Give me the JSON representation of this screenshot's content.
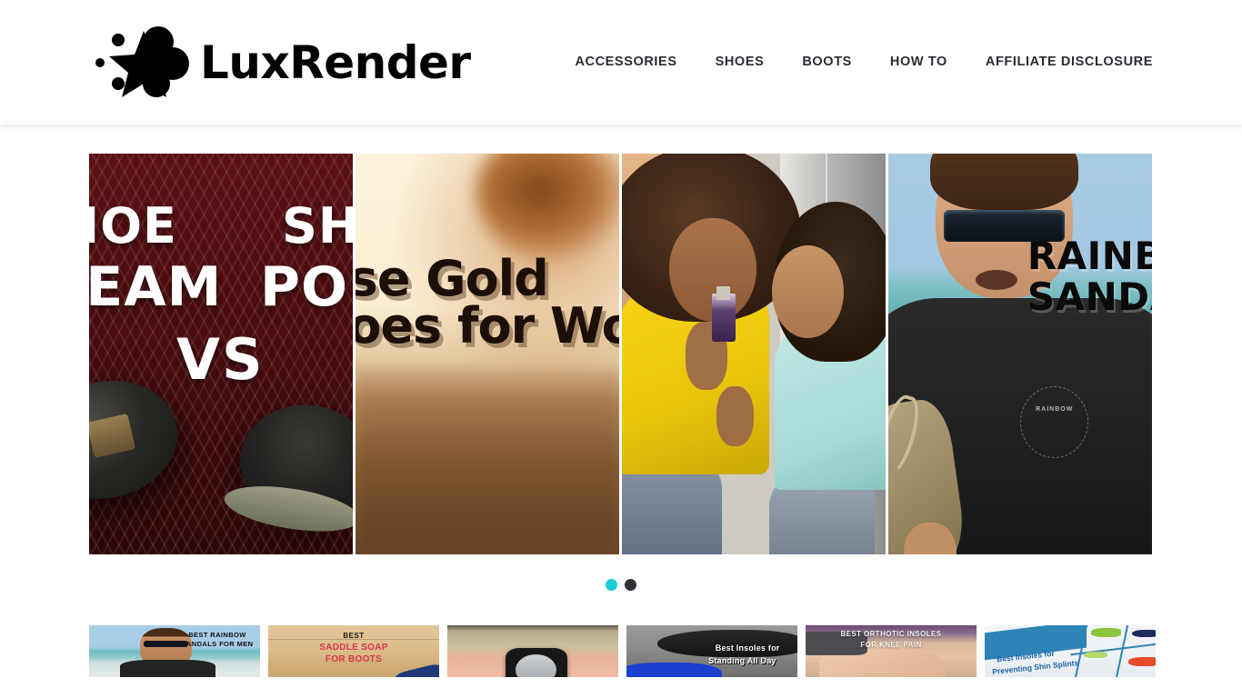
{
  "site": {
    "brand_name": "LuxRender",
    "logo_icon": "star-splat-icon"
  },
  "nav": {
    "items": [
      {
        "label": "ACCESSORIES"
      },
      {
        "label": "SHOES"
      },
      {
        "label": "BOOTS"
      },
      {
        "label": "HOW TO"
      },
      {
        "label": "AFFILIATE DISCLOSURE"
      }
    ]
  },
  "carousel": {
    "slides": [
      {
        "name": "shoe-cream-vs-shoe-polish",
        "line_left_1": "SHOE",
        "line_left_2": "CREAM",
        "line_right_1": "SHOE",
        "line_right_2": "POLISH",
        "vs": "VS"
      },
      {
        "name": "rose-gold-shoes-for-women",
        "title": "Rose Gold\nShoes for Women"
      },
      {
        "name": "essential-oils-mother-and-child",
        "title": ""
      },
      {
        "name": "rainbow-sandals",
        "title": "RAINBOW\nSANDALS",
        "shirt_logo": "RAINBOW"
      }
    ],
    "dots": [
      {
        "label": "1",
        "active": true
      },
      {
        "label": "2",
        "active": false
      }
    ],
    "active_dot_color": "#19cdd6",
    "inactive_dot_color": "#2d3136"
  },
  "thumbnails": [
    {
      "name": "best-rainbow-sandals-for-men",
      "caption": "BEST RAINBOW SANDALS FOR MEN"
    },
    {
      "name": "best-saddle-soap-for-boots",
      "best": "BEST",
      "line1": "SADDLE SOAP",
      "line2": "FOR BOOTS"
    },
    {
      "name": "watch-review",
      "caption": ""
    },
    {
      "name": "best-insoles-for-standing-all-day",
      "line1": "Best Insoles for",
      "line2": "Standing All Day"
    },
    {
      "name": "best-orthotic-insoles-for-knee-pain",
      "line1": "BEST ORTHOTIC INSOLES",
      "line2": "FOR KNEE PAIN"
    },
    {
      "name": "best-insoles-for-preventing-shin-splints",
      "line1": "Best Insoles for",
      "line2": "Preventing Shin Splints"
    }
  ]
}
